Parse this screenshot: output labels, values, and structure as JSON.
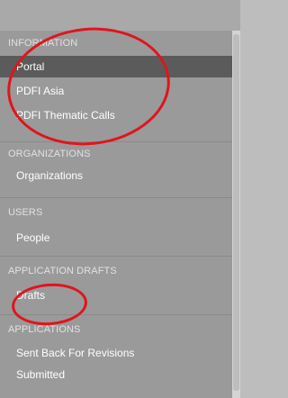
{
  "sidebar": {
    "sections": [
      {
        "header": "INFORMATION",
        "items": [
          {
            "label": "Portal",
            "active": true
          },
          {
            "label": "PDFI Asia",
            "active": false
          },
          {
            "label": "PDFI Thematic Calls",
            "active": false
          }
        ]
      },
      {
        "header": "ORGANIZATIONS",
        "items": [
          {
            "label": "Organizations",
            "active": false
          }
        ]
      },
      {
        "header": "USERS",
        "items": [
          {
            "label": "People",
            "active": false
          }
        ]
      },
      {
        "header": "APPLICATION DRAFTS",
        "items": [
          {
            "label": "Drafts",
            "active": false
          }
        ]
      },
      {
        "header": "APPLICATIONS",
        "items": [
          {
            "label": "Sent Back For Revisions",
            "active": false
          },
          {
            "label": "Submitted",
            "active": false
          }
        ]
      }
    ]
  },
  "colors": {
    "sidebar_bg": "#9a9a9a",
    "active_item_bg": "#5b5b5b",
    "annotation_red": "#e0141e"
  }
}
